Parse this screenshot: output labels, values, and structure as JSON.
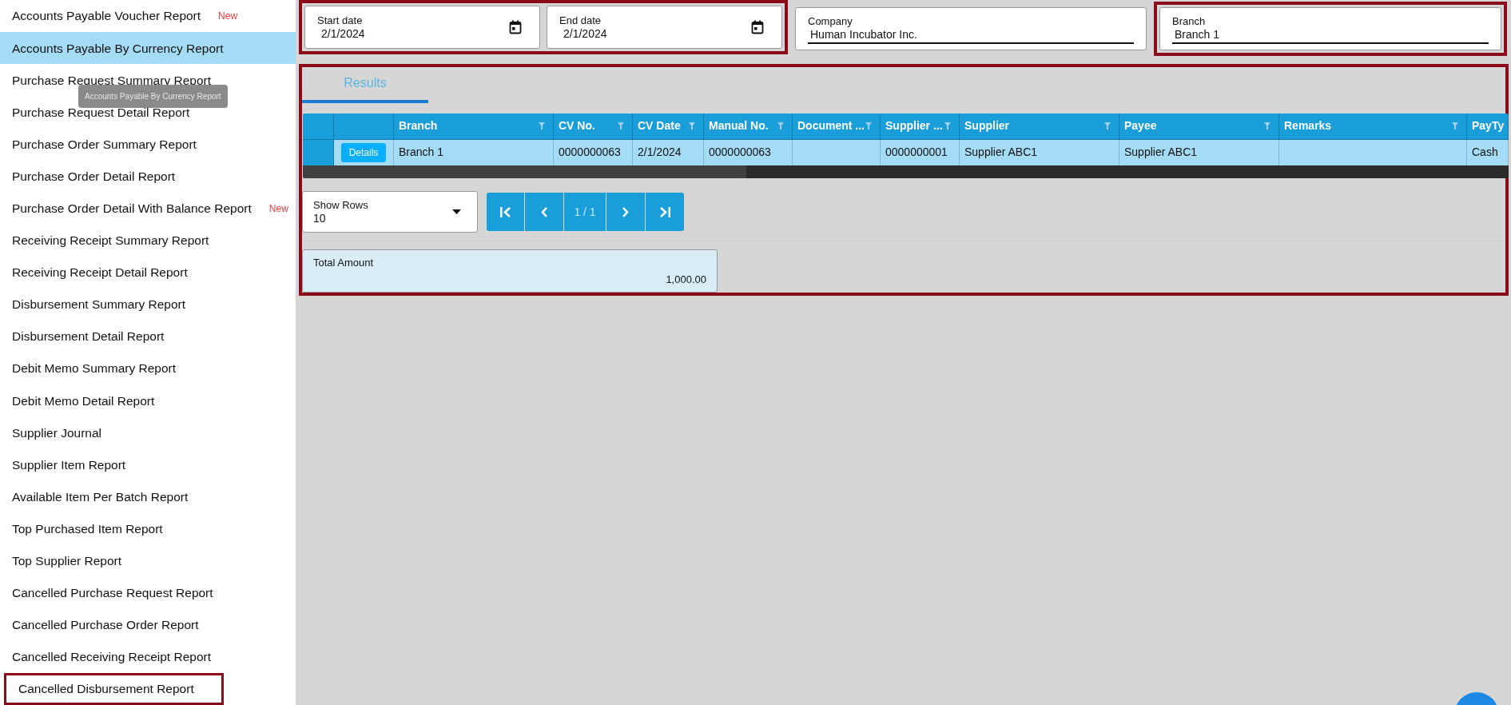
{
  "sidebar": {
    "items": [
      {
        "label": "Accounts Payable Voucher Report",
        "badge": "New",
        "selected": false,
        "highlighted": false
      },
      {
        "label": "Accounts Payable By Currency Report",
        "selected": true,
        "highlighted": false
      },
      {
        "label": "Purchase Request Summary Report",
        "selected": false,
        "highlighted": false
      },
      {
        "label": "Purchase Request Detail Report",
        "selected": false,
        "highlighted": false
      },
      {
        "label": "Purchase Order Summary Report",
        "selected": false,
        "highlighted": false
      },
      {
        "label": "Purchase Order Detail Report",
        "selected": false,
        "highlighted": false
      },
      {
        "label": "Purchase Order Detail With Balance Report",
        "badge": "New",
        "selected": false,
        "highlighted": false
      },
      {
        "label": "Receiving Receipt Summary Report",
        "selected": false,
        "highlighted": false
      },
      {
        "label": "Receiving Receipt Detail Report",
        "selected": false,
        "highlighted": false
      },
      {
        "label": "Disbursement Summary Report",
        "selected": false,
        "highlighted": false
      },
      {
        "label": "Disbursement Detail Report",
        "selected": false,
        "highlighted": false
      },
      {
        "label": "Debit Memo Summary Report",
        "selected": false,
        "highlighted": false
      },
      {
        "label": "Debit Memo Detail Report",
        "selected": false,
        "highlighted": false
      },
      {
        "label": "Supplier Journal",
        "selected": false,
        "highlighted": false
      },
      {
        "label": "Supplier Item Report",
        "selected": false,
        "highlighted": false
      },
      {
        "label": "Available Item Per Batch Report",
        "selected": false,
        "highlighted": false
      },
      {
        "label": "Top Purchased Item Report",
        "selected": false,
        "highlighted": false
      },
      {
        "label": "Top Supplier Report",
        "selected": false,
        "highlighted": false
      },
      {
        "label": "Cancelled Purchase Request Report",
        "selected": false,
        "highlighted": false
      },
      {
        "label": "Cancelled Purchase Order Report",
        "selected": false,
        "highlighted": false
      },
      {
        "label": "Cancelled Receiving Receipt Report",
        "selected": false,
        "highlighted": false
      },
      {
        "label": "Cancelled Disbursement Report",
        "selected": false,
        "highlighted": true
      }
    ]
  },
  "tooltip": {
    "text": "Accounts Payable By Currency Report"
  },
  "filters": {
    "date_range": {
      "highlighted": true,
      "fields": [
        {
          "label": "Start date",
          "value": "2/1/2024"
        },
        {
          "label": "End date",
          "value": "2/1/2024"
        }
      ]
    },
    "company": {
      "label": "Company",
      "value": "Human Incubator Inc.",
      "highlighted": false
    },
    "branch": {
      "label": "Branch",
      "value": "Branch 1",
      "highlighted": true
    }
  },
  "results": {
    "highlighted": true,
    "tabs": [
      {
        "label": "Results",
        "selected": true
      }
    ],
    "table": {
      "columns": [
        {
          "label": "Branch",
          "filter": true
        },
        {
          "label": "CV No.",
          "filter": true
        },
        {
          "label": "CV Date",
          "filter": true
        },
        {
          "label": "Manual No.",
          "filter": true
        },
        {
          "label": "Document ...",
          "filter": true
        },
        {
          "label": "Supplier ...",
          "filter": true
        },
        {
          "label": "Supplier",
          "filter": true
        },
        {
          "label": "Payee",
          "filter": true
        },
        {
          "label": "Remarks",
          "filter": true
        },
        {
          "label": "PayTy",
          "filter": false
        }
      ],
      "rows": [
        {
          "selected": true,
          "action": "Details",
          "cells": [
            "Branch 1",
            "0000000063",
            "2/1/2024",
            "0000000063",
            "",
            "0000000001",
            "Supplier ABC1",
            "Supplier ABC1",
            "",
            "Cash"
          ]
        }
      ]
    },
    "pagination": {
      "show_rows_label": "Show Rows",
      "show_rows_value": "10",
      "page": "1 / 1"
    },
    "total": {
      "label": "Total Amount",
      "value": "1,000.00"
    }
  }
}
